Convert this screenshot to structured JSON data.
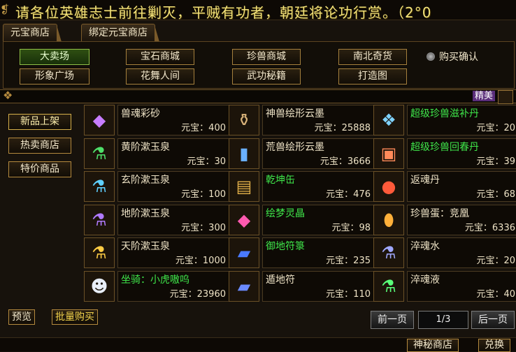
{
  "marquee": {
    "text": "请各位英雄志士前往剿灭，平贼有功者，朝廷将论功行赏。（2°0"
  },
  "tabs": [
    "元宝商店",
    "绑定元宝商店"
  ],
  "categories_row1": [
    "大卖场",
    "宝石商城",
    "珍兽商城",
    "南北奇货"
  ],
  "categories_row2": [
    "形象广场",
    "花舞人间",
    "武功秘籍",
    "打造图"
  ],
  "buy_confirm": "购买确认",
  "jingmei": "精美",
  "side_menu": [
    "新品上架",
    "热卖商店",
    "特价商品"
  ],
  "currency": "元宝：",
  "items": [
    {
      "name": "兽魂彩砂",
      "price": "400",
      "green": false,
      "icon": "gem-icon",
      "glyph": "◆",
      "color": "#c77dff"
    },
    {
      "name": "神兽绘形云墨",
      "price": "25888",
      "green": false,
      "icon": "ink-stone-icon",
      "glyph": "⚱",
      "color": "#d9b37a"
    },
    {
      "name": "超级珍兽滋补丹",
      "price": "20",
      "green": true,
      "icon": "pill-box-icon",
      "glyph": "❖",
      "color": "#7fd3ff"
    },
    {
      "name": "黄阶漱玉泉",
      "price": "30",
      "green": false,
      "icon": "green-potion-icon",
      "glyph": "⚗",
      "color": "#4fe06a"
    },
    {
      "name": "荒兽绘形云墨",
      "price": "3666",
      "green": false,
      "icon": "ink-bottle-icon",
      "glyph": "▮",
      "color": "#6ab0ff"
    },
    {
      "name": "超级珍兽回春丹",
      "price": "39",
      "green": true,
      "icon": "chest-icon",
      "glyph": "▣",
      "color": "#ff8a5a"
    },
    {
      "name": "玄阶漱玉泉",
      "price": "100",
      "green": false,
      "icon": "blue-potion-icon",
      "glyph": "⚗",
      "color": "#5fd0ff"
    },
    {
      "name": "乾坤缶",
      "price": "476",
      "green": true,
      "icon": "treasure-box-icon",
      "glyph": "▤",
      "color": "#e2b04a"
    },
    {
      "name": "返魂丹",
      "price": "68",
      "green": false,
      "icon": "red-orb-icon",
      "glyph": "●",
      "color": "#ff5a3a"
    },
    {
      "name": "地阶漱玉泉",
      "price": "300",
      "green": false,
      "icon": "purple-potion-icon",
      "glyph": "⚗",
      "color": "#b07aff"
    },
    {
      "name": "绘梦灵晶",
      "price": "98",
      "green": true,
      "icon": "crystal-icon",
      "glyph": "◆",
      "color": "#ff5ab0"
    },
    {
      "name": "珍兽蛋：竞凰",
      "price": "6336",
      "green": false,
      "icon": "egg-icon",
      "glyph": "⬮",
      "color": "#ffb03a"
    },
    {
      "name": "天阶漱玉泉",
      "price": "1000",
      "green": false,
      "icon": "gold-potion-icon",
      "glyph": "⚗",
      "color": "#ffcc44"
    },
    {
      "name": "御地符箓",
      "price": "235",
      "green": true,
      "icon": "book-icon",
      "glyph": "▰",
      "color": "#4a7aff"
    },
    {
      "name": "淬魂水",
      "price": "20",
      "green": false,
      "icon": "flask-icon",
      "glyph": "⚗",
      "color": "#a0a8ff"
    },
    {
      "name": "坐骑：小虎嗷呜",
      "price": "23960",
      "green": true,
      "icon": "tiger-mount-icon",
      "glyph": "☻",
      "color": "#e8eef8"
    },
    {
      "name": "遁地符",
      "price": "110",
      "green": false,
      "icon": "talisman-icon",
      "glyph": "▰",
      "color": "#6a8aff"
    },
    {
      "name": "淬魂液",
      "price": "40",
      "green": false,
      "icon": "green-flask-icon",
      "glyph": "⚗",
      "color": "#5aff7a"
    }
  ],
  "bottom": {
    "preview": "预览",
    "bulk_buy": "批量购买"
  },
  "pagination": {
    "prev": "前一页",
    "page": "1/3",
    "next": "后一页"
  },
  "footer": {
    "mystery_shop": "神秘商店",
    "exchange": "兑换"
  }
}
